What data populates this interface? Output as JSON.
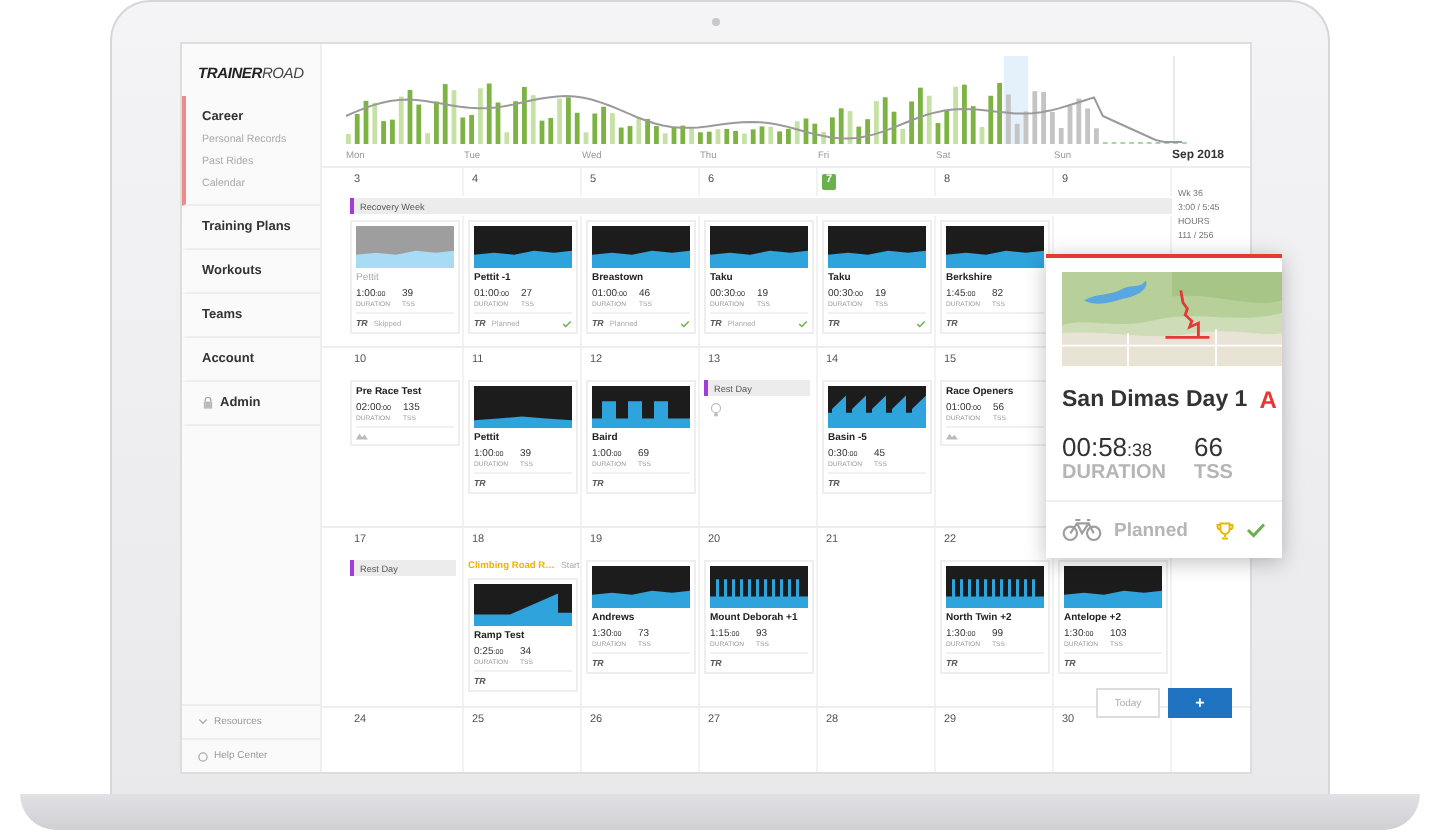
{
  "logo": "**TRAINER**ROAD",
  "sidebar": {
    "items": [
      {
        "label": "Career",
        "selected": true,
        "children": [
          {
            "label": "Personal Records"
          },
          {
            "label": "Past Rides"
          },
          {
            "label": "Calendar"
          }
        ]
      },
      {
        "label": "Training Plans",
        "selected": false
      },
      {
        "label": "Workouts",
        "selected": false
      },
      {
        "label": "Teams",
        "selected": false
      },
      {
        "label": "Account",
        "selected": false
      },
      {
        "label": "Admin",
        "selected": false,
        "kind": "locked"
      }
    ],
    "footer": [
      {
        "label": "Resources",
        "kind": "resources"
      },
      {
        "label": "Help Center",
        "kind": "help"
      }
    ]
  },
  "chart": {
    "day_labels": [
      "Mon",
      "Tue",
      "Wed",
      "Thu",
      "Fri",
      "Sat",
      "Sun"
    ],
    "month": "Sep 2018"
  },
  "weeks": [
    {
      "banner": {
        "label": "Recovery Week"
      },
      "summary": [
        "Wk 36",
        "3:00 / 5:45",
        "HOURS",
        "111 / 256"
      ],
      "days": [
        {
          "day": "3",
          "today": false,
          "events": [
            {
              "kind": "workout",
              "name": "Pettit",
              "duration": "1:00",
              "seconds": ":00",
              "tss": "39",
              "duration_label": "DURATION",
              "tss_label": "TSS",
              "profile": {
                "kind": "steady"
              },
              "skipped": true,
              "source": {
                "kind": "tr",
                "label": "TR"
              },
              "status": "Skipped",
              "completed": false
            }
          ]
        },
        {
          "day": "4",
          "today": false,
          "events": [
            {
              "kind": "workout",
              "name": "Pettit -1",
              "duration": "01:00",
              "seconds": ":00",
              "tss": "27",
              "duration_label": "DURATION",
              "tss_label": "TSS",
              "profile": {
                "kind": "steady"
              },
              "skipped": false,
              "source": {
                "kind": "tr",
                "label": "TR"
              },
              "status": "Planned",
              "completed": true
            }
          ]
        },
        {
          "day": "5",
          "today": false,
          "events": [
            {
              "kind": "workout",
              "name": "Breastown",
              "duration": "01:00",
              "seconds": ":00",
              "tss": "46",
              "duration_label": "DURATION",
              "tss_label": "TSS",
              "profile": {
                "kind": "steady"
              },
              "skipped": false,
              "source": {
                "kind": "tr",
                "label": "TR"
              },
              "status": "Planned",
              "completed": true
            }
          ]
        },
        {
          "day": "6",
          "today": false,
          "events": [
            {
              "kind": "workout",
              "name": "Taku",
              "duration": "00:30",
              "seconds": ":00",
              "tss": "19",
              "duration_label": "DURATION",
              "tss_label": "TSS",
              "profile": {
                "kind": "steady"
              },
              "skipped": false,
              "source": {
                "kind": "tr",
                "label": "TR"
              },
              "status": "Planned",
              "completed": true
            }
          ]
        },
        {
          "day": "7",
          "today": true,
          "events": [
            {
              "kind": "workout",
              "name": "Taku",
              "duration": "00:30",
              "seconds": ":00",
              "tss": "19",
              "duration_label": "DURATION",
              "tss_label": "TSS",
              "profile": {
                "kind": "steady"
              },
              "skipped": false,
              "source": {
                "kind": "tr",
                "label": "TR"
              },
              "completed": true
            }
          ]
        },
        {
          "day": "8",
          "today": false,
          "events": [
            {
              "kind": "workout",
              "name": "Berkshire",
              "duration": "1:45",
              "seconds": ":00",
              "tss": "82",
              "duration_label": "DURATION",
              "tss_label": "TSS",
              "profile": {
                "kind": "steady"
              },
              "skipped": false,
              "source": {
                "kind": "tr",
                "label": "TR"
              },
              "completed": false
            }
          ]
        },
        {
          "day": "9",
          "today": false
        }
      ]
    },
    {
      "days": [
        {
          "day": "10",
          "today": false,
          "events": [
            {
              "kind": "workout",
              "name": "Pre Race Test",
              "duration": "02:00",
              "seconds": ":00",
              "tss": "135",
              "duration_label": "DURATION",
              "tss_label": "TSS",
              "skipped": false,
              "source": {
                "kind": "outside"
              },
              "completed": false
            }
          ]
        },
        {
          "day": "11",
          "today": false,
          "events": [
            {
              "kind": "workout",
              "name": "Pettit",
              "duration": "1:00",
              "seconds": ":00",
              "tss": "39",
              "duration_label": "DURATION",
              "tss_label": "TSS",
              "profile": {
                "kind": "low"
              },
              "skipped": false,
              "source": {
                "kind": "tr",
                "label": "TR"
              },
              "completed": false
            }
          ]
        },
        {
          "day": "12",
          "today": false,
          "events": [
            {
              "kind": "workout",
              "name": "Baird",
              "duration": "1:00",
              "seconds": ":00",
              "tss": "69",
              "duration_label": "DURATION",
              "tss_label": "TSS",
              "profile": {
                "kind": "blocks"
              },
              "skipped": false,
              "source": {
                "kind": "tr",
                "label": "TR"
              },
              "completed": false
            }
          ]
        },
        {
          "day": "13",
          "today": false,
          "events": [
            {
              "kind": "note",
              "label": "Rest Day"
            },
            {
              "kind": "tip"
            }
          ]
        },
        {
          "day": "14",
          "today": false,
          "events": [
            {
              "kind": "workout",
              "name": "Basin -5",
              "duration": "0:30",
              "seconds": ":00",
              "tss": "45",
              "duration_label": "DURATION",
              "tss_label": "TSS",
              "profile": {
                "kind": "sawtooth"
              },
              "skipped": false,
              "source": {
                "kind": "tr",
                "label": "TR"
              },
              "completed": false
            }
          ]
        },
        {
          "day": "15",
          "today": false,
          "events": [
            {
              "kind": "workout",
              "name": "Race Openers",
              "duration": "01:00",
              "seconds": ":00",
              "tss": "56",
              "duration_label": "DURATION",
              "tss_label": "TSS",
              "skipped": false,
              "source": {
                "kind": "outside"
              },
              "completed": false
            }
          ]
        }
      ]
    },
    {
      "days": [
        {
          "day": "17",
          "today": false,
          "events": [
            {
              "kind": "note",
              "label": "Rest Day"
            }
          ]
        },
        {
          "day": "18",
          "today": false,
          "events": [
            {
              "kind": "plan",
              "label": "Climbing Road R…",
              "action": "Start"
            },
            {
              "kind": "workout",
              "name": "Ramp Test",
              "duration": "0:25",
              "seconds": ":00",
              "tss": "34",
              "duration_label": "DURATION",
              "tss_label": "TSS",
              "profile": {
                "kind": "ramp"
              },
              "skipped": false,
              "source": {
                "kind": "tr",
                "label": "TR"
              },
              "completed": false
            }
          ]
        },
        {
          "day": "19",
          "today": false,
          "events": [
            {
              "kind": "workout",
              "name": "Andrews",
              "duration": "1:30",
              "seconds": ":00",
              "tss": "73",
              "duration_label": "DURATION",
              "tss_label": "TSS",
              "profile": {
                "kind": "steady"
              },
              "skipped": false,
              "source": {
                "kind": "tr",
                "label": "TR"
              },
              "completed": false
            }
          ]
        },
        {
          "day": "20",
          "today": false,
          "events": [
            {
              "kind": "workout",
              "name": "Mount Deborah +1",
              "duration": "1:15",
              "seconds": ":00",
              "tss": "93",
              "duration_label": "DURATION",
              "tss_label": "TSS",
              "profile": {
                "kind": "spikes"
              },
              "skipped": false,
              "source": {
                "kind": "tr",
                "label": "TR"
              },
              "completed": false
            }
          ]
        },
        {
          "day": "21",
          "today": false
        },
        {
          "day": "22",
          "today": false,
          "events": [
            {
              "kind": "workout",
              "name": "North Twin +2",
              "duration": "1:30",
              "seconds": ":00",
              "tss": "99",
              "duration_label": "DURATION",
              "tss_label": "TSS",
              "profile": {
                "kind": "spikes"
              },
              "skipped": false,
              "source": {
                "kind": "tr",
                "label": "TR"
              },
              "completed": false
            }
          ]
        },
        {
          "events": [
            {
              "kind": "workout",
              "name": "Antelope +2",
              "duration": "1:30",
              "seconds": ":00",
              "tss": "103",
              "duration_label": "DURATION",
              "tss_label": "TSS",
              "profile": {
                "kind": "steady"
              },
              "skipped": false,
              "source": {
                "kind": "tr",
                "label": "TR"
              },
              "completed": false
            }
          ]
        }
      ]
    },
    {
      "days": [
        {
          "day": "24",
          "today": false
        },
        {
          "day": "25",
          "today": false
        },
        {
          "day": "26",
          "today": false
        },
        {
          "day": "27",
          "today": false
        },
        {
          "day": "28",
          "today": false
        },
        {
          "day": "29",
          "today": false
        },
        {
          "day": "30",
          "today": false
        }
      ]
    }
  ],
  "popup": {
    "title": "San Dimas Day 1",
    "priority": "A",
    "duration": "00:58",
    "seconds": ":38",
    "tss": "66",
    "duration_label": "DURATION",
    "tss_label": "TSS",
    "status": "Planned",
    "goal": true,
    "completed": true
  },
  "buttons": {
    "today": "Today",
    "add": "+"
  }
}
